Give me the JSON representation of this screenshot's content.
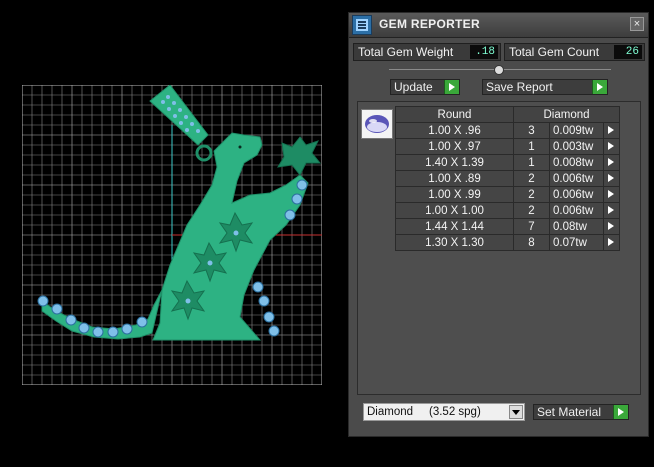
{
  "panel": {
    "title": "GEM REPORTER"
  },
  "stats": {
    "weight_label": "Total Gem Weight",
    "weight_value": ".18",
    "count_label": "Total Gem Count",
    "count_value": "26"
  },
  "buttons": {
    "update": "Update",
    "save_report": "Save Report",
    "set_material": "Set Material"
  },
  "table": {
    "headers": [
      "Round",
      "Diamond"
    ],
    "rows": [
      {
        "size": "1.00 X .96",
        "qty": "3",
        "weight": "0.009tw"
      },
      {
        "size": "1.00 X .97",
        "qty": "1",
        "weight": "0.003tw"
      },
      {
        "size": "1.40 X 1.39",
        "qty": "1",
        "weight": "0.008tw"
      },
      {
        "size": "1.00 X .89",
        "qty": "2",
        "weight": "0.006tw"
      },
      {
        "size": "1.00 X .99",
        "qty": "2",
        "weight": "0.006tw"
      },
      {
        "size": "1.00 X 1.00",
        "qty": "2",
        "weight": "0.006tw"
      },
      {
        "size": "1.44 X 1.44",
        "qty": "7",
        "weight": "0.08tw"
      },
      {
        "size": "1.30 X 1.30",
        "qty": "8",
        "weight": "0.07tw"
      }
    ]
  },
  "material": {
    "selected": "Diamond     (3.52 spg)"
  },
  "colors": {
    "model": "#2db283",
    "model_dark": "#1f8f68",
    "gem": "#7fbfe8",
    "grid": "#9a9a9a",
    "go_button": "#3aa83a"
  },
  "icons": {
    "title": "gem-reporter-icon",
    "close": "close-icon",
    "go": "play-arrow-icon",
    "gem_preview": "round-gem-icon",
    "dropdown": "chevron-down-icon"
  }
}
